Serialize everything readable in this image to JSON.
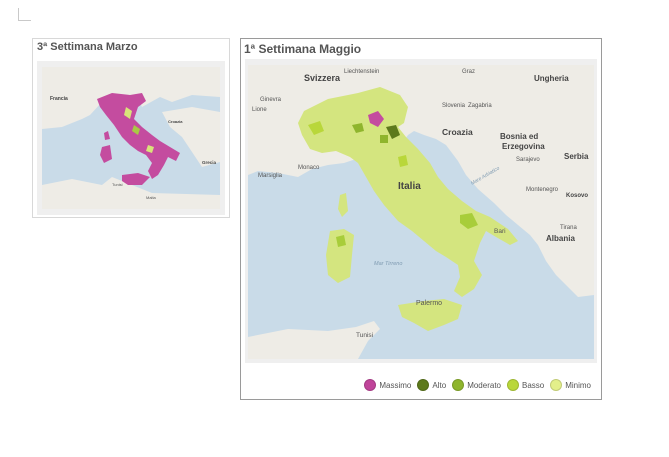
{
  "panels": {
    "march": {
      "title": "3ª Settimana Marzo"
    },
    "may": {
      "title": "1ª Settimana Maggio"
    }
  },
  "legend": [
    {
      "label": "Massimo",
      "color": "#c0449a"
    },
    {
      "label": "Alto",
      "color": "#5d7a1c"
    },
    {
      "label": "Moderato",
      "color": "#8fb52d"
    },
    {
      "label": "Basso",
      "color": "#b9d73a"
    },
    {
      "label": "Minimo",
      "color": "#e3ef8a"
    }
  ],
  "map_large": {
    "labels": {
      "svizzera": "Svizzera",
      "liechtenstein": "Liechtenstein",
      "graz": "Graz",
      "ungheria": "Ungheria",
      "ginevra": "Ginevra",
      "lione": "Lione",
      "slovenia": "Slovenia",
      "zagabria": "Zagabria",
      "croazia": "Croazia",
      "bosnia": "Bosnia ed",
      "erzegovina": "Erzegovina",
      "sarajevo": "Sarajevo",
      "serbia": "Serbia",
      "monaco": "Monaco",
      "marsiglia": "Marsiglia",
      "italia": "Italia",
      "montenegro": "Montenegro",
      "kosovo": "Kosovo",
      "tirana": "Tirana",
      "albania": "Albania",
      "bari": "Bari",
      "palermo": "Palermo",
      "tunisi": "Tunisi",
      "tirreno": "Mar Tirreno",
      "adriatico": "Mare Adriatico"
    }
  },
  "map_small": {
    "labels": {
      "francia": "Francia",
      "croazia": "Croazia",
      "grecia": "Grecia",
      "tunisi": "Tunisi",
      "malta": "Malta"
    }
  }
}
